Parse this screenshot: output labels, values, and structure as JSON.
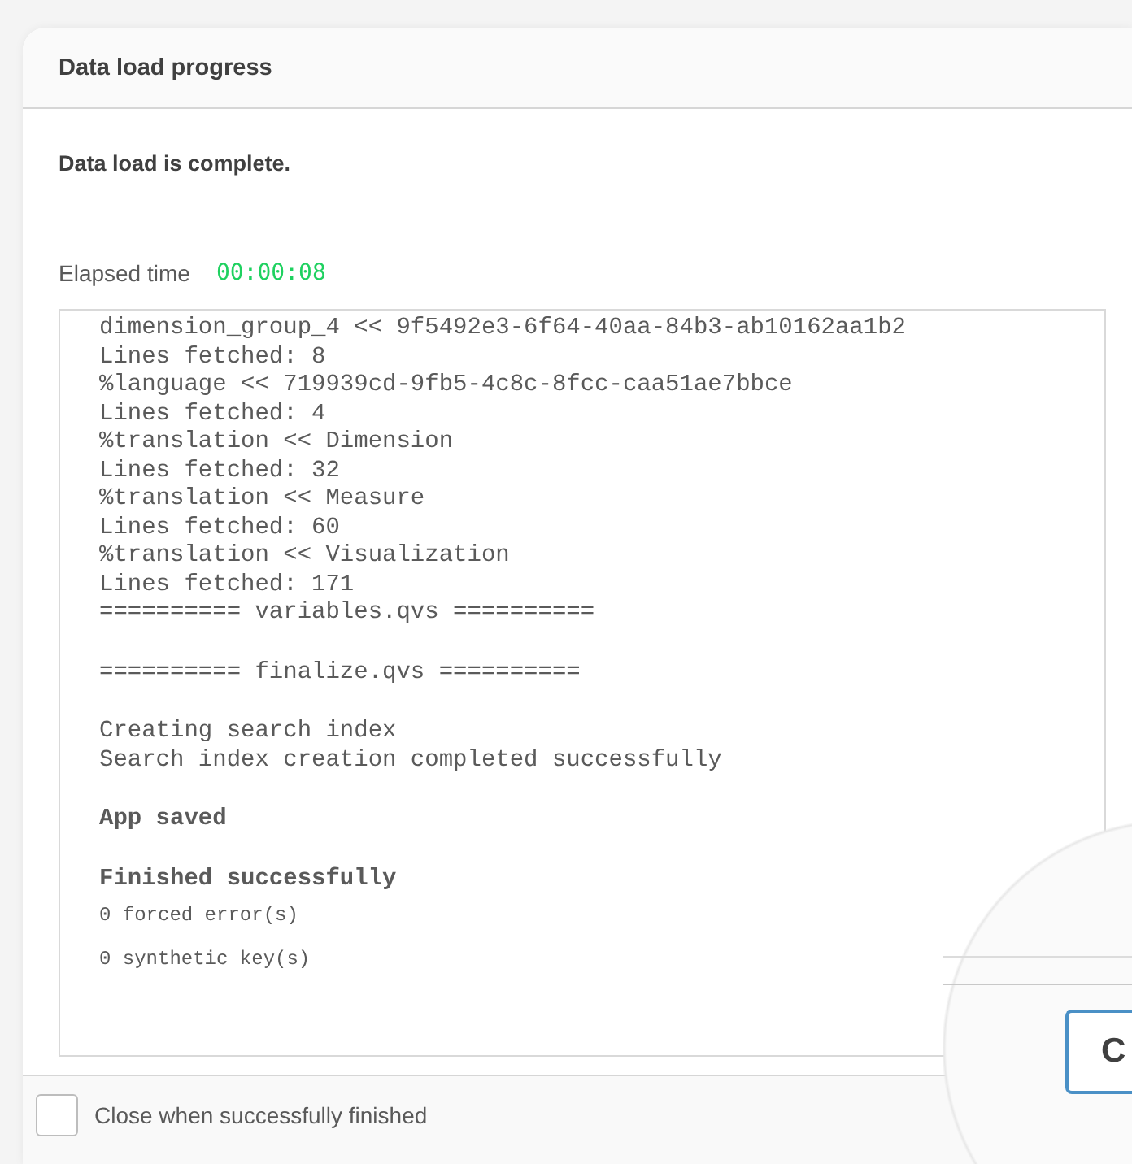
{
  "dialog": {
    "title": "Data load progress",
    "status": "Data load is complete.",
    "elapsed": {
      "label": "Elapsed time",
      "value": "00:00:08"
    },
    "log": [
      {
        "lines": [
          {
            "text": "dimension_group_4 << 9f5492e3-6f64-40aa-84b3-ab10162aa1b2",
            "kind": "normal"
          },
          {
            "text": "Lines fetched: 8",
            "kind": "normal"
          },
          {
            "text": "%language << 719939cd-9fb5-4c8c-8fcc-caa51ae7bbce",
            "kind": "normal"
          },
          {
            "text": "Lines fetched: 4",
            "kind": "normal"
          },
          {
            "text": "%translation << Dimension",
            "kind": "normal"
          },
          {
            "text": "Lines fetched: 32",
            "kind": "normal"
          },
          {
            "text": "%translation << Measure",
            "kind": "normal"
          },
          {
            "text": "Lines fetched: 60",
            "kind": "normal"
          },
          {
            "text": "%translation << Visualization",
            "kind": "normal"
          },
          {
            "text": "Lines fetched: 171",
            "kind": "normal"
          },
          {
            "text": "========== variables.qvs ==========",
            "kind": "normal"
          }
        ]
      },
      {
        "lines": [
          {
            "text": "========== finalize.qvs ==========",
            "kind": "normal"
          }
        ]
      },
      {
        "lines": [
          {
            "text": "Creating search index",
            "kind": "normal"
          },
          {
            "text": "Search index creation completed successfully",
            "kind": "normal"
          }
        ]
      },
      {
        "lines": [
          {
            "text": "App saved",
            "kind": "bold"
          }
        ]
      },
      {
        "lines": [
          {
            "text": "Finished successfully",
            "kind": "bold"
          },
          {
            "text": "0 forced error(s)",
            "kind": "small"
          },
          {
            "text": "0 synthetic key(s)",
            "kind": "small"
          }
        ]
      }
    ],
    "footer": {
      "checkbox": {
        "label": "Close when successfully finished",
        "checked": false
      }
    }
  },
  "magnifier": {
    "button_label": "C"
  }
}
